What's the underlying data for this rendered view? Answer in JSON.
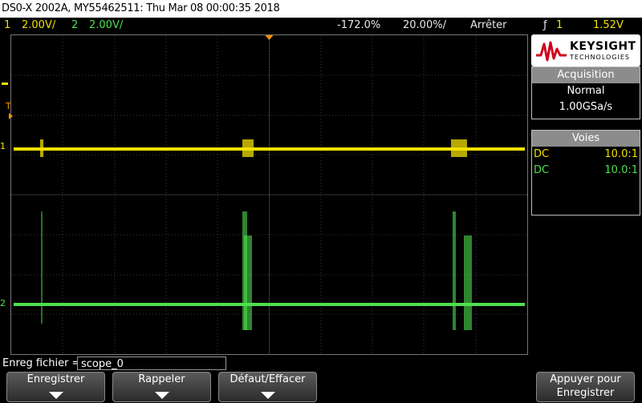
{
  "title": "DS0-X 2002A, MY55462511: Thu Mar 08 00:00:35 2018",
  "status": {
    "ch1_num": "1",
    "ch1_scale": "2.00V/",
    "ch2_num": "2",
    "ch2_scale": "2.00V/",
    "time_offset": "-172.0%",
    "time_scale": "20.00%/",
    "run_state": "Arrêter",
    "trigger_icon": "trigger-edge-icon",
    "trigger_symbol": "ƒ",
    "trigger_channel": "1",
    "trigger_level": "1.52V"
  },
  "brand": {
    "name": "KEYSIGHT",
    "sub": "TECHNOLOGIES"
  },
  "acquisition": {
    "header": "Acquisition",
    "mode": "Normal",
    "rate": "1.00GSa/s"
  },
  "channels": {
    "header": "Voies",
    "rows": [
      {
        "coupling": "DC",
        "probe": "10.0:1",
        "color": "#f3e000"
      },
      {
        "coupling": "DC",
        "probe": "10.0:1",
        "color": "#4ee04e"
      }
    ]
  },
  "markers": {
    "ch1": "1",
    "ch2": "2",
    "trigger": "T"
  },
  "filename": {
    "label": "Enreg fichier =",
    "value": "scope_0"
  },
  "softkeys": [
    {
      "label": "Enregistrer",
      "label2": ""
    },
    {
      "label": "Rappeler",
      "label2": ""
    },
    {
      "label": "Défaut/Effacer",
      "label2": ""
    },
    {
      "label": "Appuyer pour",
      "label2": "Enregistrer"
    }
  ],
  "colors": {
    "ch1": "#f3e000",
    "ch2": "#4ee04e",
    "accent": "#f29400"
  }
}
